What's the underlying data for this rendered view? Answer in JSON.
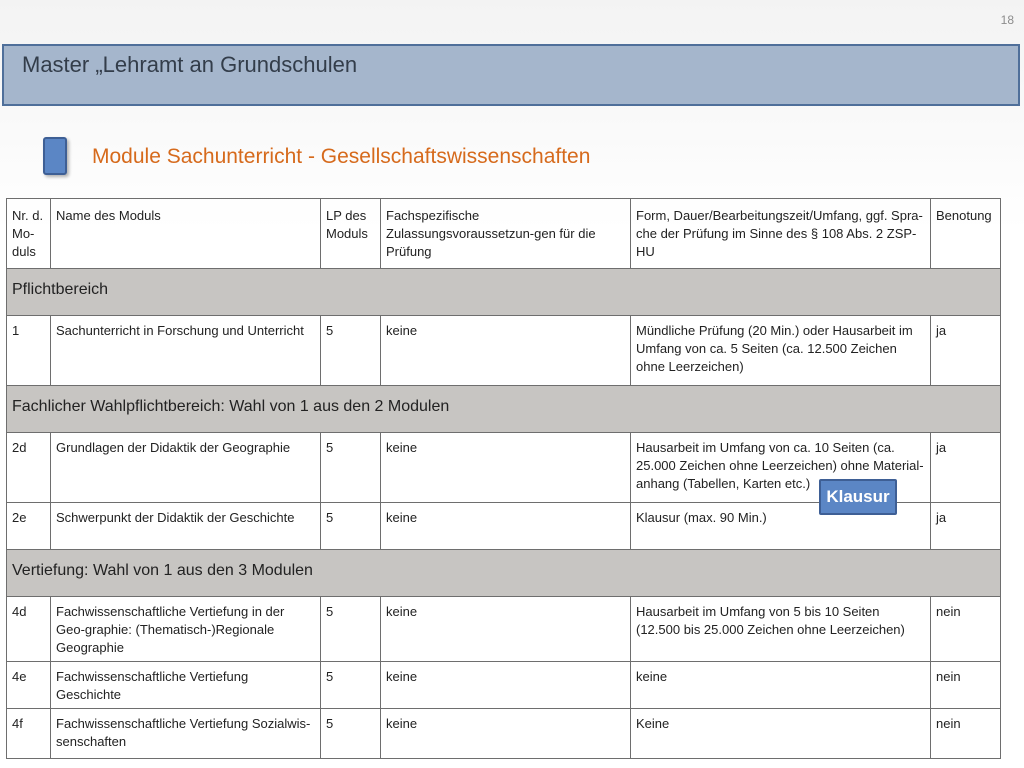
{
  "page_number": "18",
  "title": "Master „Lehramt an Grundschulen",
  "subtitle": "Module Sachunterricht - Gesellschaftswissenschaften",
  "table": {
    "headers": [
      "Nr. d. Mo-duls",
      "Name des Moduls",
      "LP des Moduls",
      "Fachspezifische Zulassungsvoraussetzun-gen für die Prüfung",
      "Form, Dauer/Bearbeitungszeit/Umfang, ggf. Spra-che der Prüfung im Sinne des § 108 Abs. 2 ZSP-HU",
      "Benotung"
    ],
    "sections": [
      {
        "title": "Pflichtbereich",
        "rows": [
          [
            "1",
            "Sachunterricht in Forschung und Unterricht",
            "5",
            "keine",
            "Mündliche Prüfung (20 Min.) oder Hausarbeit im Umfang von ca. 5 Seiten (ca. 12.500 Zeichen ohne Leerzeichen)",
            "ja"
          ]
        ]
      },
      {
        "title": "Fachlicher Wahlpflichtbereich: Wahl von 1 aus den 2 Modulen",
        "rows": [
          [
            "2d",
            "Grundlagen der Didaktik der Geographie",
            "5",
            "keine",
            "Hausarbeit im Umfang von ca. 10 Seiten (ca. 25.000 Zeichen ohne Leerzeichen) ohne Material-anhang (Tabellen, Karten etc.)",
            "ja"
          ],
          [
            "2e",
            "Schwerpunkt der Didaktik der Geschichte",
            "5",
            "keine",
            "Klausur (max. 90 Min.)",
            "ja"
          ]
        ]
      },
      {
        "title": "Vertiefung: Wahl von 1 aus den 3 Modulen",
        "rows": [
          [
            "4d",
            "Fachwissenschaftliche Vertiefung in der Geo-graphie: (Thematisch-)Regionale Geographie",
            "5",
            "keine",
            "Hausarbeit im Umfang von 5 bis 10 Seiten (12.500 bis 25.000 Zeichen ohne Leerzeichen)",
            "nein"
          ],
          [
            "4e",
            "Fachwissenschaftliche Vertiefung Geschichte",
            "5",
            "keine",
            "keine",
            "nein"
          ],
          [
            "4f",
            "Fachwissenschaftliche Vertiefung Sozialwis-senschaften",
            "5",
            "keine",
            "Keine",
            "nein"
          ]
        ]
      }
    ]
  },
  "overlay_button": "Klausur",
  "colors": {
    "title_bar": "#a5b6cc",
    "title_border": "#4f6f9a",
    "accent_blue": "#5b86c5",
    "subtitle_orange": "#d66a1c",
    "section_gray": "#c7c5c2"
  }
}
